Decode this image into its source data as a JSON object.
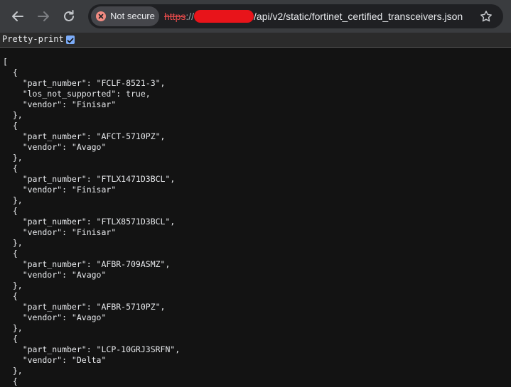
{
  "browser": {
    "security_label": "Not secure",
    "url_scheme": "https",
    "url_separator": "://",
    "url_path": "/api/v2/static/fortinet_certified_transceivers.json",
    "icons": [
      "back-arrow-icon",
      "forward-arrow-icon",
      "reload-icon",
      "warning-icon",
      "star-icon"
    ],
    "redaction_color": "#e8141a"
  },
  "viewer": {
    "pretty_print_label": "Pretty-print",
    "pretty_print_checked": true
  },
  "json_lines": [
    "[",
    "  {",
    "    \"part_number\": \"FCLF-8521-3\",",
    "    \"los_not_supported\": true,",
    "    \"vendor\": \"Finisar\"",
    "  },",
    "  {",
    "    \"part_number\": \"AFCT-5710PZ\",",
    "    \"vendor\": \"Avago\"",
    "  },",
    "  {",
    "    \"part_number\": \"FTLX1471D3BCL\",",
    "    \"vendor\": \"Finisar\"",
    "  },",
    "  {",
    "    \"part_number\": \"FTLX8571D3BCL\",",
    "    \"vendor\": \"Finisar\"",
    "  },",
    "  {",
    "    \"part_number\": \"AFBR-709ASMZ\",",
    "    \"vendor\": \"Avago\"",
    "  },",
    "  {",
    "    \"part_number\": \"AFBR-5710PZ\",",
    "    \"vendor\": \"Avago\"",
    "  },",
    "  {",
    "    \"part_number\": \"LCP-10GRJ3SRFN\",",
    "    \"vendor\": \"Delta\"",
    "  },",
    "  {"
  ]
}
